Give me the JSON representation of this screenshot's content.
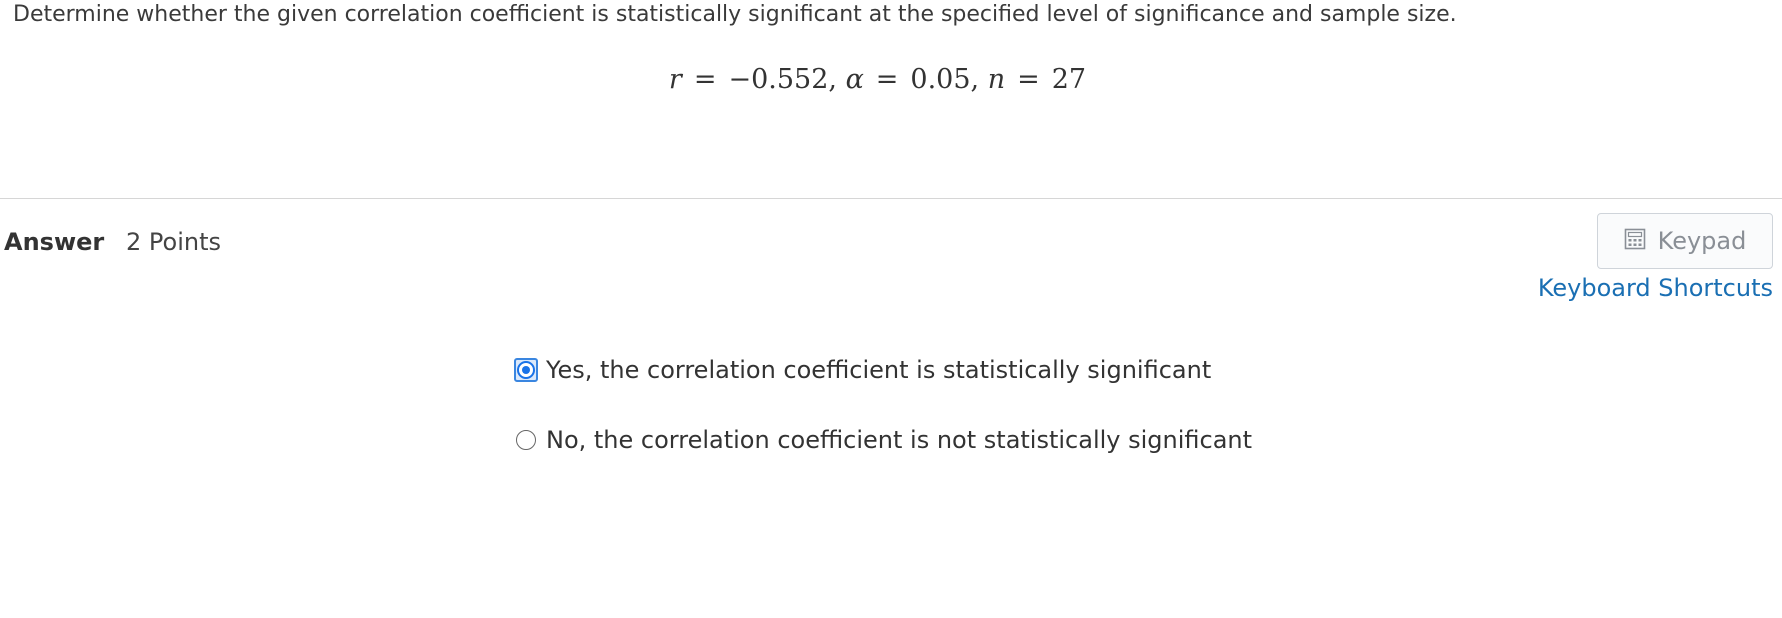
{
  "question": {
    "prompt": "Determine whether the given correlation coefficient is statistically significant at the specified level of significance and sample size.",
    "math": {
      "r_symbol": "r",
      "eq": "=",
      "r_value": "−0.552,",
      "alpha_symbol": "α",
      "alpha_value": "0.05,",
      "n_symbol": "n",
      "n_value": "27"
    }
  },
  "answer": {
    "label": "Answer",
    "points": "2 Points"
  },
  "toolbar": {
    "keypad_label": "Keypad",
    "keypad_icon": "calculator-icon",
    "shortcuts_label": "Keyboard Shortcuts"
  },
  "options": [
    {
      "label": "Yes, the correlation coefficient is statistically significant",
      "selected": true
    },
    {
      "label": "No, the correlation coefficient is not statistically significant",
      "selected": false
    }
  ],
  "colors": {
    "link": "#1a6fb3",
    "radio_selected": "#1a73e8",
    "divider": "#d6d6d6"
  }
}
